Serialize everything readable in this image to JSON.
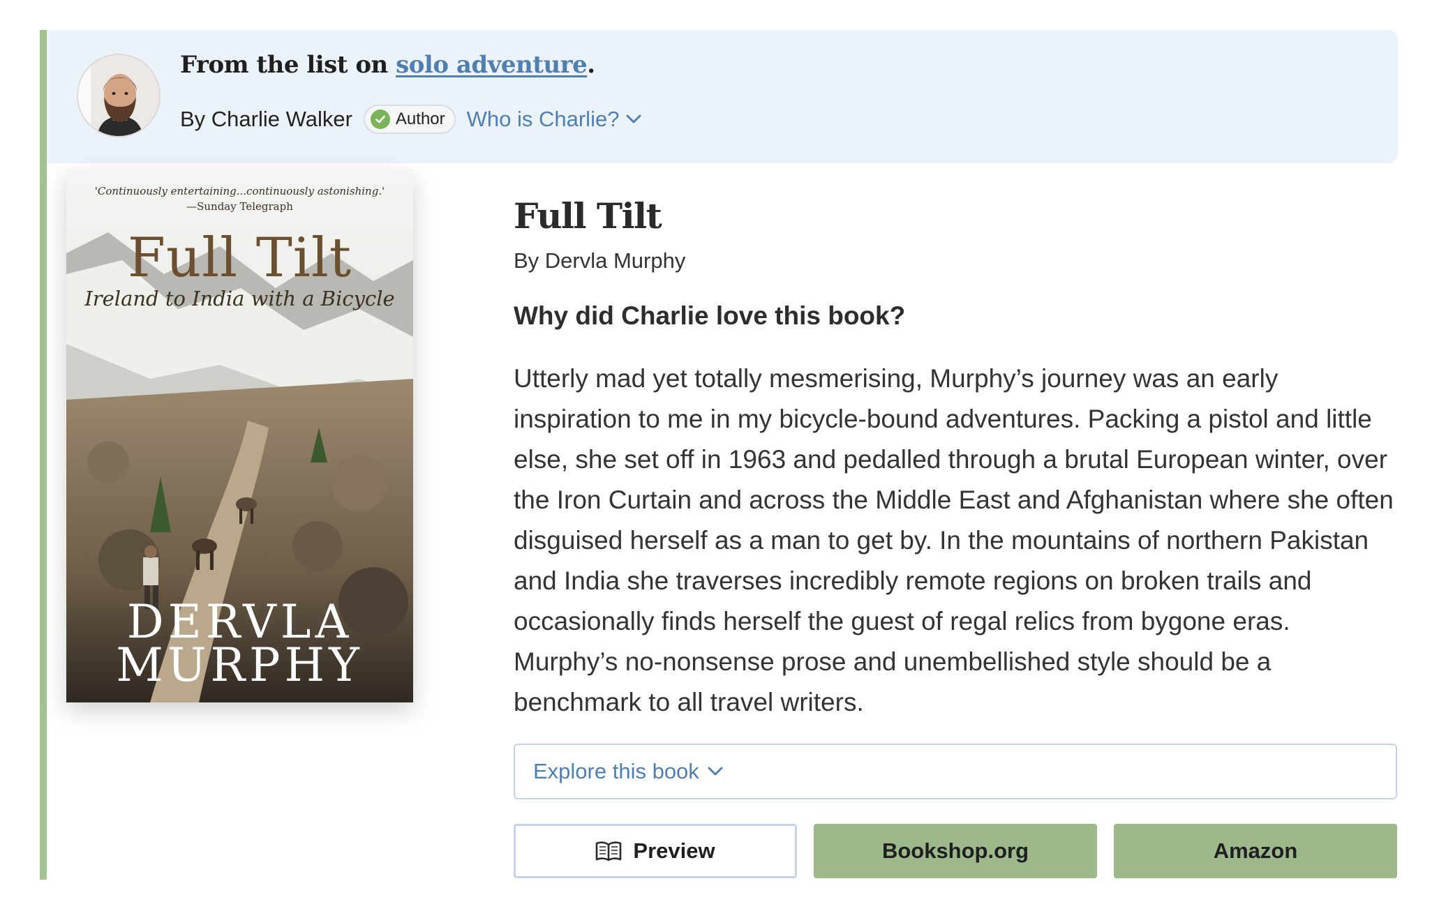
{
  "header": {
    "list_prefix": "From the list on ",
    "list_name": "solo adventure",
    "list_suffix": ".",
    "byline": "By Charlie Walker",
    "author_badge": "Author",
    "who_link": "Who is Charlie?"
  },
  "cover": {
    "quote": "'Continuously entertaining...continuously astonishing.'",
    "quote_source": "—Sunday Telegraph",
    "title": "Full Tilt",
    "subtitle": "Ireland to India with a Bicycle",
    "author_first": "DERVLA",
    "author_last": "MURPHY"
  },
  "book": {
    "title": "Full Tilt",
    "author": "By Dervla Murphy",
    "why_heading": "Why did Charlie love this book?",
    "review": "Utterly mad yet totally mesmerising, Murphy’s journey was an early inspiration to me in my bicycle-bound adventures. Packing a pistol and little else, she set off in 1963 and pedalled through a brutal European winter, over the Iron Curtain and across the Middle East and Afghanistan where she often disguised herself as a man to get by. In the mountains of northern Pakistan and India she traverses incredibly remote regions on broken trails and occasionally finds herself the guest of regal relics from bygone eras. Murphy’s no-nonsense prose and unembellished style should be a benchmark to all travel writers."
  },
  "actions": {
    "explore": "Explore this book",
    "preview": "Preview",
    "bookshop": "Bookshop.org",
    "amazon": "Amazon"
  },
  "colors": {
    "accent_green": "#a3c18f",
    "header_bg": "#ecf2fa",
    "link_blue": "#4f7fae",
    "button_green": "#9db98b"
  },
  "icons": [
    "check-icon",
    "chevron-down-icon",
    "book-open-icon"
  ]
}
